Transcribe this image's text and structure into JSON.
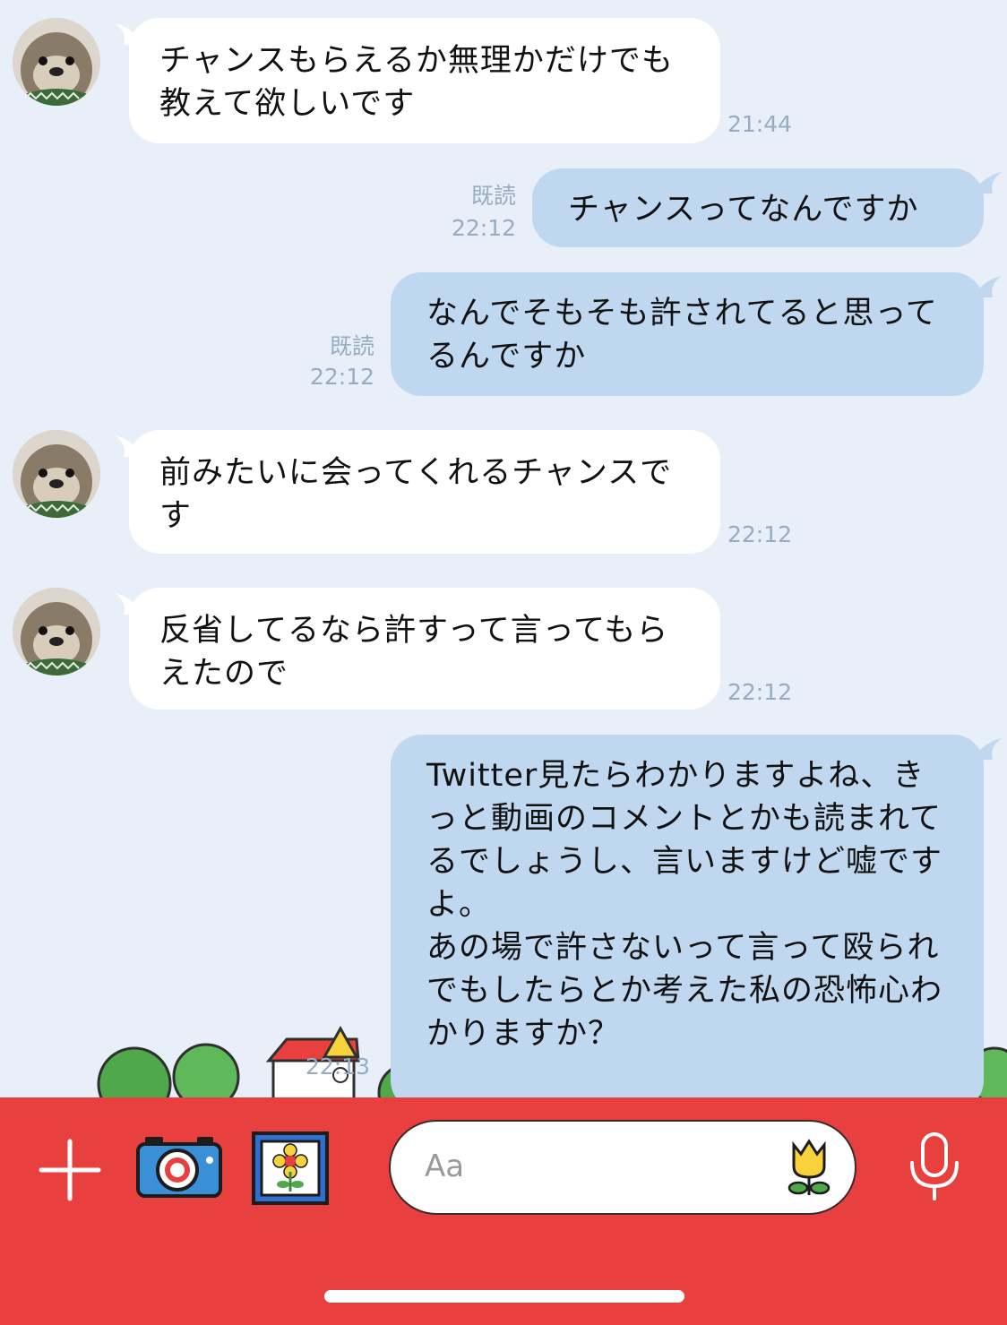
{
  "messages": [
    {
      "text": "チャンスもらえるか無理かだけでも教えて欲しいです",
      "time": "21:44"
    },
    {
      "text": "チャンスってなんですか",
      "read": "既読",
      "time": "22:12"
    },
    {
      "text": "なんでそもそも許されてると思ってるんですか",
      "read": "既読",
      "time": "22:12"
    },
    {
      "text": "前みたいに会ってくれるチャンスです",
      "time": "22:12"
    },
    {
      "text": "反省してるなら許すって言ってもらえたので",
      "time": "22:12"
    },
    {
      "text": "Twitter見たらわかりますよね、きっと動画のコメントとかも読まれてるでしょうし、言いますけど嘘ですよ。\nあの場で許さないって言って殴られでもしたらとか考えた私の恐怖心わかりますか？",
      "time": "22:13"
    }
  ],
  "input": {
    "placeholder": "Aa"
  },
  "colors": {
    "background": "#e8eff8",
    "bubble_out": "#bfd8f0",
    "bubble_in": "#ffffff",
    "bottom_bar": "#e8403f",
    "meta": "#97abc2"
  },
  "icons": [
    "plus-icon",
    "camera-icon",
    "image-icon",
    "tulip-sticker-icon",
    "microphone-icon"
  ]
}
